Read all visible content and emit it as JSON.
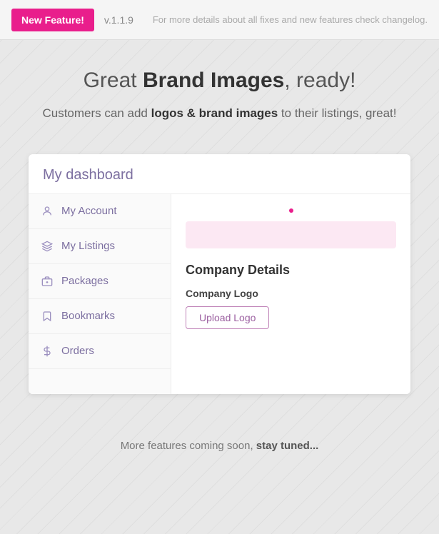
{
  "header": {
    "badge_label": "New Feature!",
    "version": "v.1.1.9",
    "changelog_text": "For more details about all fixes and new features check changelog."
  },
  "hero": {
    "title_normal": "Great ",
    "title_bold": "Brand Images",
    "title_suffix": ", ready!",
    "subtitle_prefix": "Customers can add ",
    "subtitle_bold": "logos & brand images",
    "subtitle_suffix": " to their listings, great!"
  },
  "dashboard": {
    "title": "My dashboard",
    "nav_items": [
      {
        "label": "My Account",
        "icon": "person"
      },
      {
        "label": "My Listings",
        "icon": "layers"
      },
      {
        "label": "Packages",
        "icon": "packages"
      },
      {
        "label": "Bookmarks",
        "icon": "bookmark"
      },
      {
        "label": "Orders",
        "icon": "dollar"
      }
    ],
    "main": {
      "company_details_title": "Company Details",
      "company_logo_label": "Company Logo",
      "upload_button_label": "Upload Logo"
    }
  },
  "footer": {
    "text_normal": "More features coming soon, ",
    "text_bold": "stay tuned..."
  }
}
